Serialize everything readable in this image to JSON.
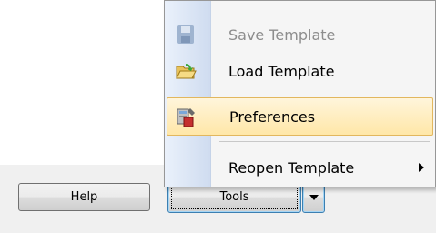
{
  "footer": {
    "help_label": "Help",
    "tools_label": "Tools"
  },
  "menu": {
    "items": [
      {
        "label": "Save Template",
        "icon": "floppy-disk-icon",
        "enabled": false
      },
      {
        "label": "Load Template",
        "icon": "open-folder-icon",
        "enabled": true
      },
      {
        "label": "Preferences",
        "icon": "preferences-icon",
        "enabled": true,
        "highlighted": true
      },
      {
        "label": "Reopen Template",
        "icon": "",
        "enabled": true,
        "submenu": true
      }
    ]
  },
  "colors": {
    "highlight": "#ffe7a8",
    "highlight_border": "#e2b75e",
    "focus_border": "#3c7fb1"
  }
}
